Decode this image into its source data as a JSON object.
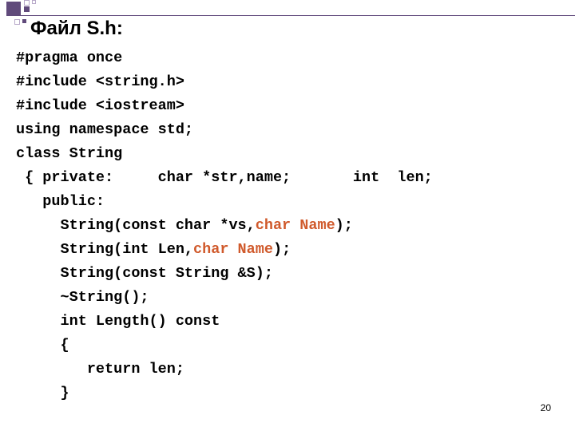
{
  "title": "Файл S.h:",
  "code": {
    "l1": "#pragma once",
    "l2": "#include <string.h>",
    "l3": "#include <iostream>",
    "l4": "using namespace std;",
    "l5": "class String",
    "l6a": " { private:     char *str,name;       int  len;",
    "l7": "   public:",
    "l8a": "     String(const char *vs,",
    "l8b": "char Name",
    "l8c": ");",
    "l9a": "     String(int Len,",
    "l9b": "char Name",
    "l9c": ");",
    "l10": "     String(const String &S);",
    "l11": "     ~String();",
    "l12": "     int Length() const",
    "l13": "     {",
    "l14": "        return len;",
    "l15": "     }"
  },
  "page_number": "20"
}
